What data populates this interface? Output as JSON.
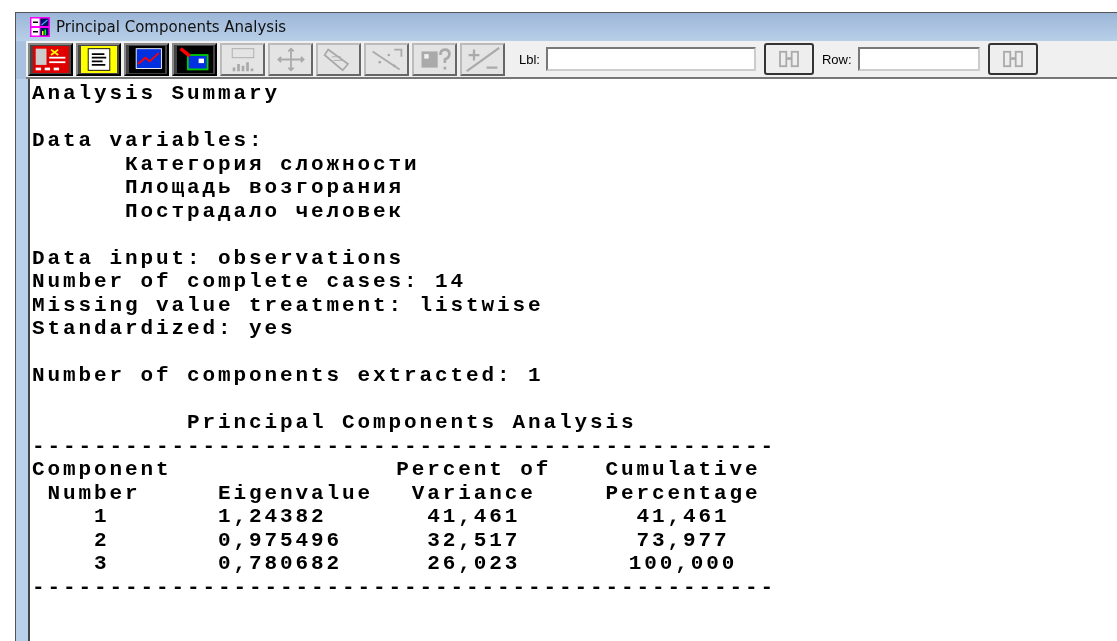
{
  "window": {
    "title": "Principal Components Analysis"
  },
  "toolbar": {
    "buttons": [
      {
        "kind": "input",
        "disabled": false
      },
      {
        "kind": "text",
        "disabled": false
      },
      {
        "kind": "graph",
        "disabled": false
      },
      {
        "kind": "save",
        "disabled": false
      },
      {
        "kind": "labels",
        "disabled": true
      },
      {
        "kind": "points",
        "disabled": true
      },
      {
        "kind": "paint",
        "disabled": true
      },
      {
        "kind": "lines",
        "disabled": true
      },
      {
        "kind": "help",
        "disabled": true
      },
      {
        "kind": "plusminus",
        "disabled": true
      }
    ],
    "label_field": {
      "label": "Lbl:"
    },
    "row_field": {
      "label": "Row:"
    }
  },
  "report": {
    "heading": "Analysis Summary",
    "variables_label": "Data variables:",
    "variables": [
      "Категория сложности",
      "Площадь возгорания",
      "Пострадало человек"
    ],
    "settings": [
      "Data input: observations",
      "Number of complete cases: 14",
      "Missing value treatment: listwise",
      "Standardized: yes"
    ],
    "components_extracted": "Number of components extracted: 1",
    "table": {
      "title": "Principal Components Analysis",
      "rule_top": "------------------------------------------------",
      "columns": [
        {
          "header": [
            "Component",
            "Number"
          ]
        },
        {
          "header": [
            "Eigenvalue"
          ]
        },
        {
          "header": [
            "Percent of",
            "Variance"
          ]
        },
        {
          "header": [
            "Cumulative",
            "Percentage"
          ]
        }
      ],
      "rows": [
        [
          "1",
          "1,24382",
          "41,461",
          "41,461"
        ],
        [
          "2",
          "0,975496",
          "32,517",
          "73,977"
        ],
        [
          "3",
          "0,780682",
          "26,023",
          "100,000"
        ]
      ],
      "rule_bottom": "------------------------------------------------"
    }
  }
}
